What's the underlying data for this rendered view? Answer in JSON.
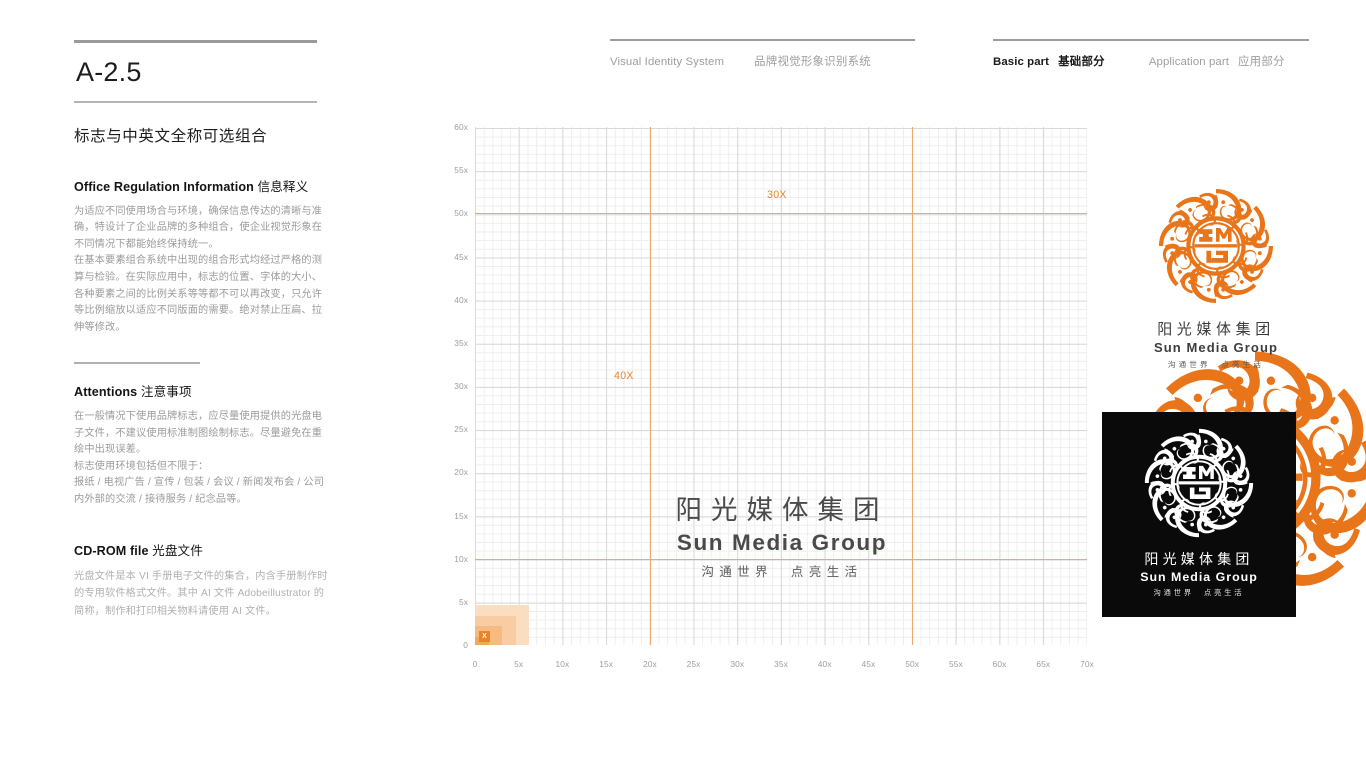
{
  "page": {
    "code": "A-2.5",
    "section_title": "标志与中英文全称可选组合"
  },
  "header": {
    "left_en": "Visual Identity System",
    "left_cn": "品牌视觉形象识别系统",
    "basic_en": "Basic part",
    "basic_cn": "基础部分",
    "application_en": "Application part",
    "application_cn": "应用部分"
  },
  "blocks": {
    "office": {
      "head_en": "Office Regulation Information",
      "head_cn": "信息释义",
      "p1": "为适应不同使用场合与环境，确保信息传达的清晰与准确，特设计了企业品牌的多种组合，使企业视觉形象在不同情况下都能始终保持统一。",
      "p2": "在基本要素组合系统中出现的组合形式均经过严格的测算与检验。在实际应用中，标志的位置、字体的大小、各种要素之间的比例关系等等都不可以再改变，只允许等比例缩放以适应不同版面的需要。绝对禁止压扁、拉伸等修改。"
    },
    "attentions": {
      "head_en": "Attentions",
      "head_cn": "注意事项",
      "p1": "在一般情况下使用品牌标志，应尽量使用提供的光盘电子文件，不建议使用标准制图绘制标志。尽量避免在重绘中出现误差。",
      "p2": "标志使用环境包括但不限于：",
      "p3": "报纸 / 电视广告 / 宣传 / 包装 / 会议 / 新闻发布会 / 公司内外部的交流 / 接待服务 / 纪念品等。"
    },
    "cdrom": {
      "head_en": "CD-ROM file",
      "head_cn": "光盘文件",
      "p1": "光盘文件是本 VI 手册电子文件的集合，内含手册制作时的专用软件格式文件。其中 AI 文件 Adobeillustrator 的简称，制作和打印相关物料请使用 AI 文件。"
    }
  },
  "logo": {
    "cn_name": "阳光媒体集团",
    "en_name": "Sun Media Group",
    "slogan": "沟通世界　点亮生活",
    "monogram": "SMG",
    "brand_orange": "#E8751A",
    "black_panel": "#0A0A0A"
  },
  "chart_data": {
    "type": "scatter",
    "title": "",
    "xlabel": "",
    "ylabel": "",
    "grid": true,
    "minor_grid": true,
    "xlim": [
      0,
      70
    ],
    "ylim": [
      0,
      60
    ],
    "x_ticks": [
      "0",
      "5x",
      "10x",
      "15x",
      "20x",
      "25x",
      "30x",
      "35x",
      "40x",
      "45x",
      "50x",
      "55x",
      "60x",
      "65x",
      "70x"
    ],
    "y_ticks": [
      "0",
      "5x",
      "10x",
      "15x",
      "20x",
      "25x",
      "30x",
      "35x",
      "40x",
      "45x",
      "50x",
      "55x",
      "60x"
    ],
    "x_tick_values": [
      0,
      5,
      10,
      15,
      20,
      25,
      30,
      35,
      40,
      45,
      50,
      55,
      60,
      65,
      70
    ],
    "y_tick_values": [
      0,
      5,
      10,
      15,
      20,
      25,
      30,
      35,
      40,
      45,
      50,
      55,
      60
    ],
    "major_step": 5,
    "minor_step": 1,
    "guides": [
      {
        "orientation": "vertical",
        "value": 20,
        "color": "#F0A868"
      },
      {
        "orientation": "vertical",
        "value": 50,
        "color": "#F0A868"
      },
      {
        "orientation": "horizontal",
        "value": 10,
        "color": "#F0A868"
      },
      {
        "orientation": "horizontal",
        "value": 50,
        "color": "#F0A868"
      }
    ],
    "annotations": [
      {
        "label": "30X",
        "x": 35,
        "y": 52,
        "color": "#E8862B"
      },
      {
        "label": "40X",
        "x": 17.5,
        "y": 31,
        "color": "#E8862B"
      }
    ],
    "unit_swatch": {
      "label": "X",
      "steps": [
        {
          "w": 1,
          "h": 0.6,
          "color": "#F1A85F"
        },
        {
          "w": 2,
          "h": 1.4,
          "color": "#F7BB81"
        },
        {
          "w": 3,
          "h": 2.2,
          "color": "#F9CDA3"
        },
        {
          "w": 4,
          "h": 3.0,
          "color": "#FBDDC0"
        }
      ]
    }
  }
}
